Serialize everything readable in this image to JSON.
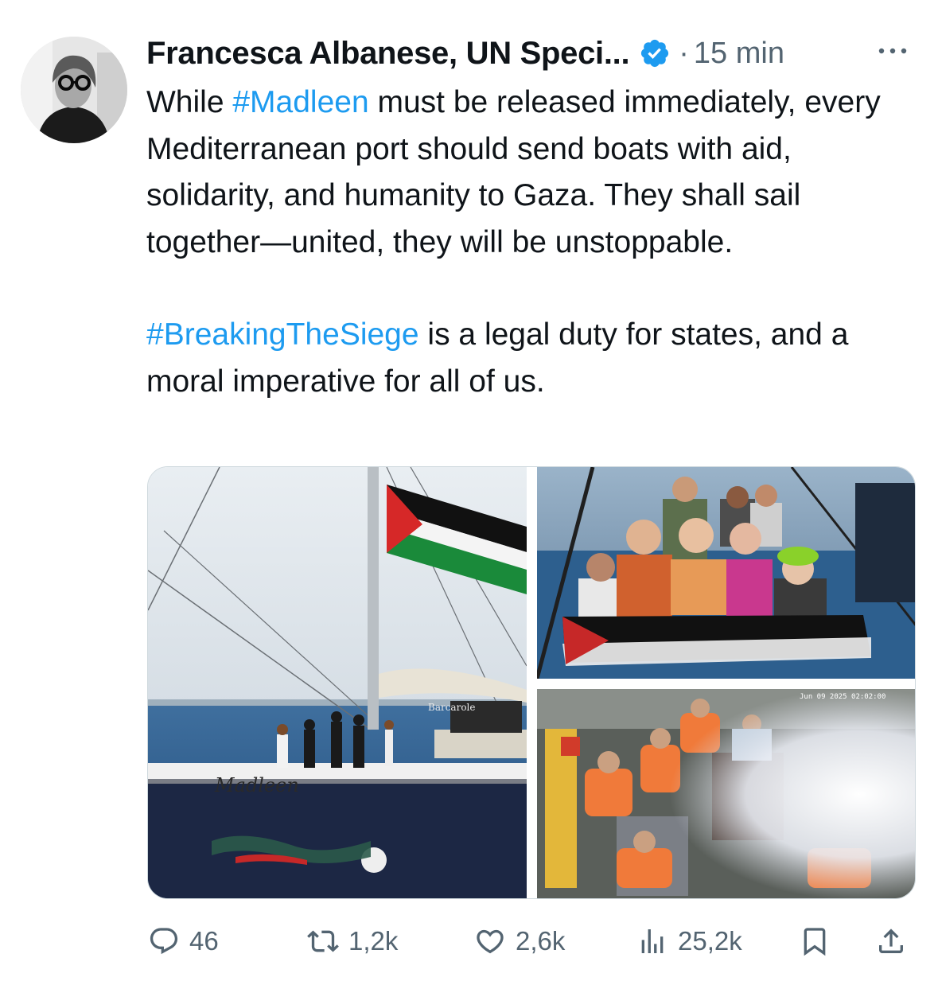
{
  "tweet": {
    "author_name": "Francesca Albanese, UN Speci...",
    "separator": "·",
    "time": "15 min",
    "verified_icon": "verified-badge-icon",
    "text": {
      "p1": [
        "While ",
        "#Madleen",
        " must be released immediately, every Mediterranean port should send boats with aid, solidarity, and humanity to Gaza. They shall sail together—united, they will be unstoppable."
      ],
      "p2": [
        "#BreakingTheSiege",
        " is a legal duty for states, and a moral imperative for all of us."
      ]
    },
    "media": {
      "photo1_hull_text": "Madleen",
      "photo1_boat_text": "Barcarole",
      "photo3_timestamp": "Jun 09 2025  02:02:00"
    },
    "actions": {
      "replies": "46",
      "reposts": "1,2k",
      "likes": "2,6k",
      "views": "25,2k"
    }
  },
  "colors": {
    "link": "#1d9bf0",
    "text": "#0f1419",
    "muted": "#536471",
    "border": "#cfd9de"
  }
}
